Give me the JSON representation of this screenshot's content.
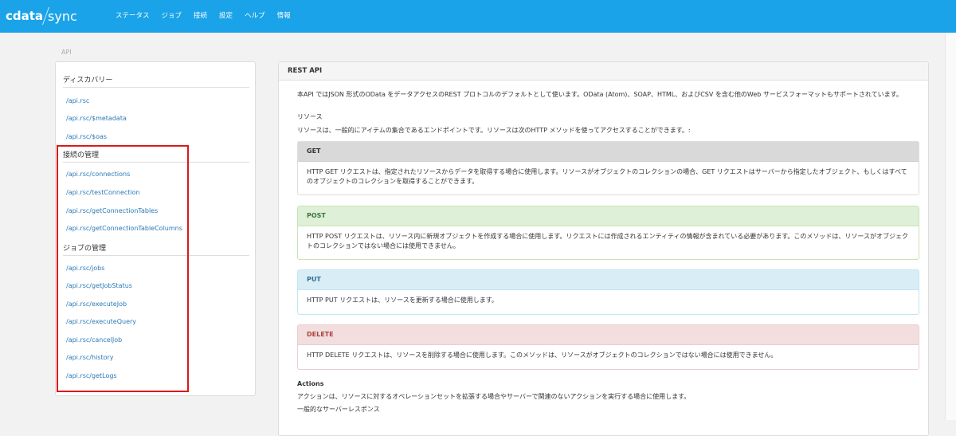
{
  "header": {
    "logo_left": "cdata",
    "logo_right": "sync",
    "nav": [
      "ステータス",
      "ジョブ",
      "接続",
      "設定",
      "ヘルプ",
      "情報"
    ]
  },
  "breadcrumb": "API",
  "sidebar": {
    "discovery_title": "ディスカバリー",
    "discovery_links": [
      "/api.rsc",
      "/api.rsc/$metadata",
      "/api.rsc/$oas"
    ],
    "connections_title": "接続の管理",
    "connections_links": [
      "/api.rsc/connections",
      "/api.rsc/testConnection",
      "/api.rsc/getConnectionTables",
      "/api.rsc/getConnectionTableColumns"
    ],
    "jobs_title": "ジョブの管理",
    "jobs_links": [
      "/api.rsc/jobs",
      "/api.rsc/getJobStatus",
      "/api.rsc/executeJob",
      "/api.rsc/executeQuery",
      "/api.rsc/cancelJob",
      "/api.rsc/history",
      "/api.rsc/getLogs"
    ]
  },
  "main": {
    "title": "REST API",
    "intro": "本API ではJSON 形式のOData をデータアクセスのREST プロトコルのデフォルトとして使います。OData (Atom)、SOAP、HTML、およびCSV を含む他のWeb サービスフォーマットもサポートされています。",
    "resources_title": "リソース",
    "resources_desc": "リソースは、一般的にアイテムの集合であるエンドポイントです。リソースは次のHTTP メソッドを使ってアクセスすることができます。:",
    "get": {
      "label": "GET",
      "desc": "HTTP GET リクエストは、指定されたリソースからデータを取得する場合に使用します。リソースがオブジェクトのコレクションの場合、GET リクエストはサーバーから指定したオブジェクト、もしくはすべてのオブジェクトのコレクションを取得することができます。"
    },
    "post": {
      "label": "POST",
      "desc": "HTTP POST リクエストは、リソース内に新規オブジェクトを作成する場合に使用します。リクエストには作成されるエンティティの情報が含まれている必要があります。このメソッドは、リソースがオブジェクトのコレクションではない場合には使用できません。"
    },
    "put": {
      "label": "PUT",
      "desc": "HTTP PUT リクエストは、リソースを更新する場合に使用します。"
    },
    "delete": {
      "label": "DELETE",
      "desc": "HTTP DELETE リクエストは、リソースを削除する場合に使用します。このメソッドは、リソースがオブジェクトのコレクションではない場合には使用できません。"
    },
    "actions_title": "Actions",
    "actions_desc": "アクションは、リソースに対するオペレーションセットを拡張する場合やサーバーで関連のないアクションを実行する場合に使用します。",
    "server_response_title": "一般的なサーバーレスポンス"
  },
  "colors": {
    "header_bg": "#1aa3e8",
    "link": "#2a7ab8",
    "highlight_border": "#d91a1a"
  }
}
